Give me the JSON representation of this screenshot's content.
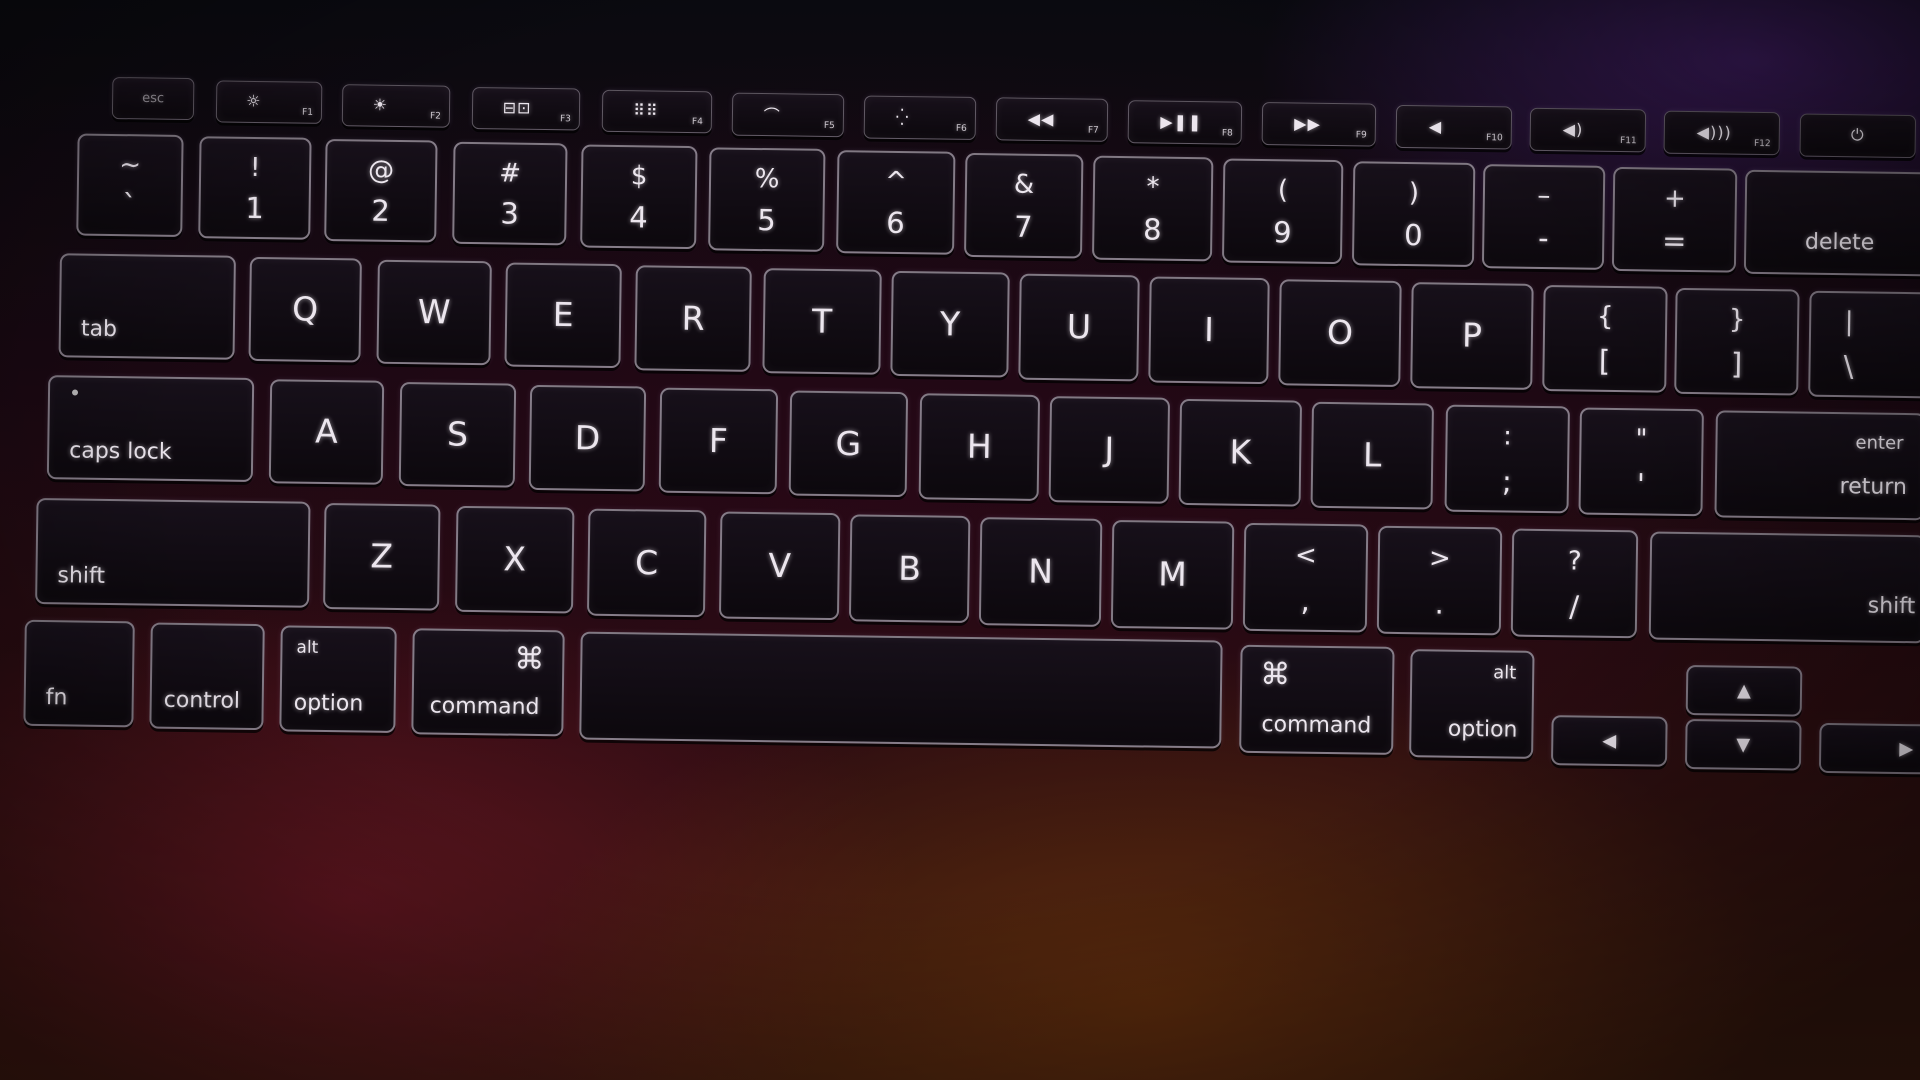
{
  "function_row": [
    {
      "kind": "esc",
      "label": "esc"
    },
    {
      "kind": "fn",
      "icon": "brightness-down-icon",
      "glyph": "☼",
      "num": "F1"
    },
    {
      "kind": "fn",
      "icon": "brightness-up-icon",
      "glyph": "☀",
      "num": "F2"
    },
    {
      "kind": "fn",
      "icon": "mission-control-icon",
      "glyph": "⊟⊡",
      "num": "F3"
    },
    {
      "kind": "fn",
      "icon": "launchpad-icon",
      "glyph": "⠿⠿",
      "num": "F4"
    },
    {
      "kind": "fn",
      "icon": "keyboard-light-down-icon",
      "glyph": "⌒",
      "num": "F5"
    },
    {
      "kind": "fn",
      "icon": "keyboard-light-up-icon",
      "glyph": "⁛",
      "num": "F6"
    },
    {
      "kind": "fn",
      "icon": "rewind-icon",
      "glyph": "◀◀",
      "num": "F7"
    },
    {
      "kind": "fn",
      "icon": "play-pause-icon",
      "glyph": "▶❚❚",
      "num": "F8"
    },
    {
      "kind": "fn",
      "icon": "fast-forward-icon",
      "glyph": "▶▶",
      "num": "F9"
    },
    {
      "kind": "fn",
      "icon": "mute-icon",
      "glyph": "◀",
      "num": "F10"
    },
    {
      "kind": "fn",
      "icon": "volume-down-icon",
      "glyph": "◀)",
      "num": "F11"
    },
    {
      "kind": "fn",
      "icon": "volume-up-icon",
      "glyph": "◀)))",
      "num": "F12"
    },
    {
      "kind": "power",
      "icon": "power-icon",
      "glyph": "⏻"
    }
  ],
  "number_row": [
    {
      "top": "~",
      "bottom": "`"
    },
    {
      "top": "!",
      "bottom": "1"
    },
    {
      "top": "@",
      "bottom": "2"
    },
    {
      "top": "#",
      "bottom": "3"
    },
    {
      "top": "$",
      "bottom": "4"
    },
    {
      "top": "%",
      "bottom": "5"
    },
    {
      "top": "^",
      "bottom": "6"
    },
    {
      "top": "&",
      "bottom": "7"
    },
    {
      "top": "*",
      "bottom": "8"
    },
    {
      "top": "(",
      "bottom": "9"
    },
    {
      "top": ")",
      "bottom": "0"
    },
    {
      "top": "–",
      "bottom": "-"
    },
    {
      "top": "+",
      "bottom": "="
    },
    {
      "label": "delete"
    }
  ],
  "qwerty_row": [
    {
      "label": "tab"
    },
    {
      "label": "Q"
    },
    {
      "label": "W"
    },
    {
      "label": "E"
    },
    {
      "label": "R"
    },
    {
      "label": "T"
    },
    {
      "label": "Y"
    },
    {
      "label": "U"
    },
    {
      "label": "I"
    },
    {
      "label": "O"
    },
    {
      "label": "P"
    },
    {
      "top": "{",
      "bottom": "["
    },
    {
      "top": "}",
      "bottom": "]"
    },
    {
      "top": "|",
      "bottom": "\\"
    }
  ],
  "home_row": [
    {
      "label": "caps lock"
    },
    {
      "label": "A"
    },
    {
      "label": "S"
    },
    {
      "label": "D"
    },
    {
      "label": "F"
    },
    {
      "label": "G"
    },
    {
      "label": "H"
    },
    {
      "label": "J"
    },
    {
      "label": "K"
    },
    {
      "label": "L"
    },
    {
      "top": ":",
      "bottom": ";"
    },
    {
      "top": "\"",
      "bottom": "'"
    },
    {
      "top": "enter",
      "bottom": "return"
    }
  ],
  "shift_row": [
    {
      "label": "shift"
    },
    {
      "label": "Z"
    },
    {
      "label": "X"
    },
    {
      "label": "C"
    },
    {
      "label": "V"
    },
    {
      "label": "B"
    },
    {
      "label": "N"
    },
    {
      "label": "M"
    },
    {
      "top": "<",
      "bottom": ","
    },
    {
      "top": ">",
      "bottom": "."
    },
    {
      "top": "?",
      "bottom": "/"
    },
    {
      "label": "shift"
    }
  ],
  "bottom_row": [
    {
      "label": "fn"
    },
    {
      "label": "control"
    },
    {
      "top": "alt",
      "bottom": "option"
    },
    {
      "symbol": "⌘",
      "bottom": "command"
    },
    {
      "label": ""
    },
    {
      "symbol": "⌘",
      "bottom": "command"
    },
    {
      "top": "alt",
      "bottom": "option"
    }
  ],
  "arrows": {
    "left": "◀",
    "up": "▲",
    "down": "▼",
    "right": "▶"
  },
  "colors": {
    "key_fill": "#0c080d",
    "key_outline": "#e1d7e6",
    "legend": "#ece6ee",
    "background_warm": "#5f2d0c",
    "background_magenta": "#69142a",
    "background_purple": "#461e6e"
  }
}
